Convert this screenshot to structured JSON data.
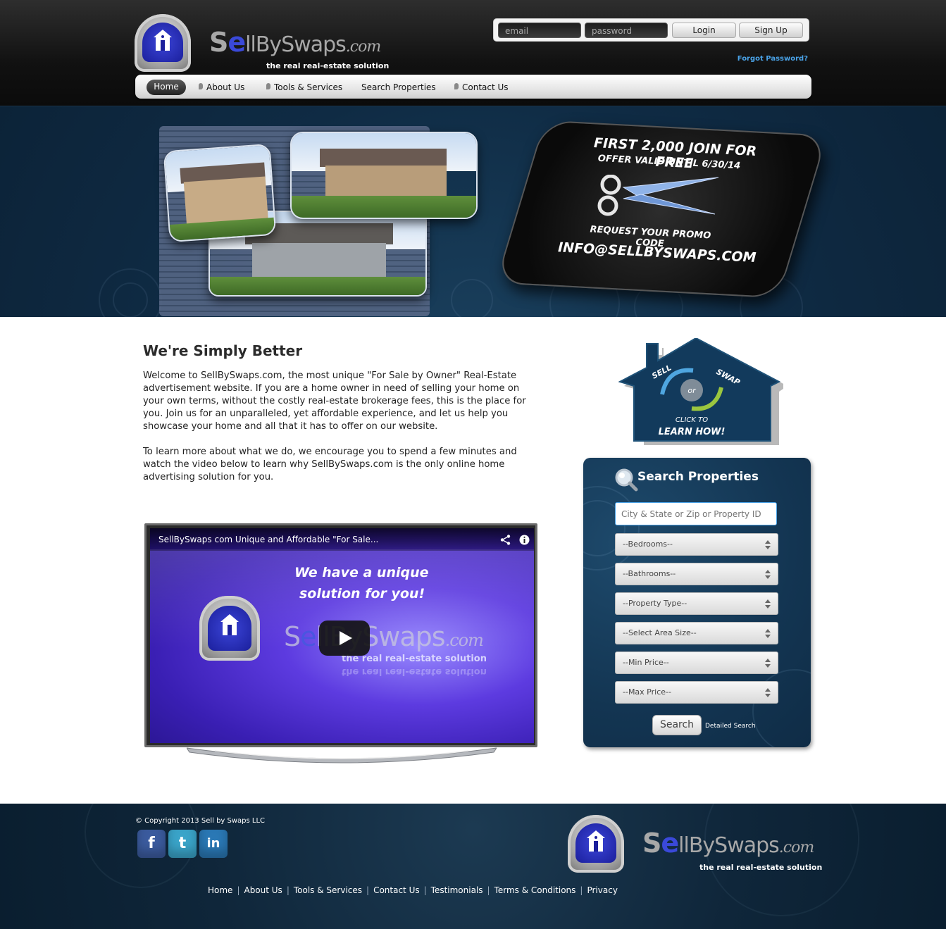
{
  "brand": {
    "name_prefix": "S",
    "name_e": "e",
    "name_rest": "llBySwaps",
    "dotcom": ".com",
    "tagline": "the real real-estate solution"
  },
  "login": {
    "email_placeholder": "email",
    "password_placeholder": "password",
    "login_label": "Login",
    "signup_label": "Sign Up",
    "forgot": "Forgot Password?"
  },
  "nav": [
    {
      "label": "Home"
    },
    {
      "label": "About Us"
    },
    {
      "label": "Tools & Services"
    },
    {
      "label": "Search Properties"
    },
    {
      "label": "Contact Us"
    }
  ],
  "promo": {
    "line1": "FIRST 2,000 JOIN FOR FREE",
    "line2": "OFFER VALID UNTIL 6/30/14",
    "line3": "REQUEST YOUR PROMO CODE",
    "line4": "INFO@SELLBYSWAPS.COM"
  },
  "main": {
    "title": "We're Simply Better",
    "para1": "Welcome to SellBySwaps.com, the most unique \"For Sale by Owner\" Real-Estate advertisement website. If you are a home owner in need of selling your home on your own terms, without the costly real-estate brokerage fees, this is the place for you. Join us for an unparalleled, yet affordable experience, and let us help you showcase your home and all that it has to offer on our website.",
    "para2": "To learn more about what we do, we encourage you to spend a few minutes and watch the video below to learn why SellBySwaps.com is the only online home advertising solution for you."
  },
  "video": {
    "title": "SellBySwaps com Unique and Affordable \"For Sale...",
    "slogan1": "We have a unique",
    "slogan2": "solution for you!",
    "tagline": "the real real-estate solution"
  },
  "sell_swap": {
    "sell": "SELL",
    "or": "or",
    "swap": "SWAP",
    "click": "CLICK TO",
    "learn": "LEARN HOW!"
  },
  "search": {
    "title": "Search Properties",
    "placeholder": "City & State or Zip or Property ID",
    "selects": [
      "--Bedrooms--",
      "--Bathrooms--",
      "--Property Type--",
      "--Select Area Size--",
      "--Min Price--",
      "--Max Price--"
    ],
    "button": "Search",
    "detailed": "Detailed Search"
  },
  "footer": {
    "copyright": "© Copyright 2013 Sell by Swaps LLC",
    "social": [
      {
        "letter": "f",
        "color": "#3b5b9e"
      },
      {
        "letter": "t",
        "color": "#3aa4c9"
      },
      {
        "letter": "in",
        "color": "#2a78b5"
      }
    ],
    "links": [
      "Home",
      "About Us",
      "Tools & Services",
      "Contact Us",
      "Testimonials",
      "Terms & Conditions",
      "Privacy"
    ]
  }
}
